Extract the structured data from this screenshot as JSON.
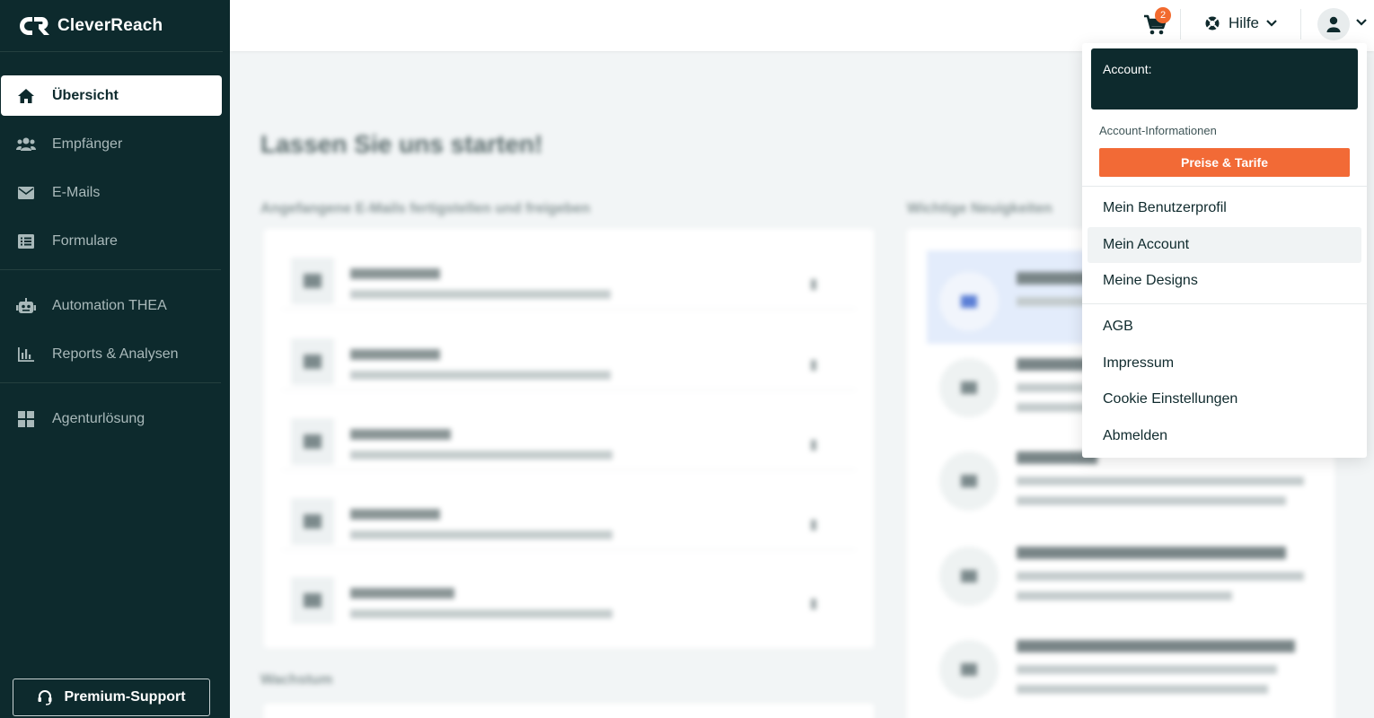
{
  "brand": {
    "name": "CleverReach"
  },
  "sidebar": {
    "items": [
      {
        "label": "Übersicht",
        "icon": "home-icon",
        "active": true
      },
      {
        "label": "Empfänger",
        "icon": "users-icon"
      },
      {
        "label": "E-Mails",
        "icon": "envelope-icon"
      },
      {
        "label": "Formulare",
        "icon": "list-icon"
      },
      {
        "label": "Automation THEA",
        "icon": "robot-icon"
      },
      {
        "label": "Reports & Analysen",
        "icon": "bar-chart-icon"
      },
      {
        "label": "Agenturlösung",
        "icon": "grid-icon"
      }
    ],
    "premium_support": "Premium-Support"
  },
  "topbar": {
    "cart_count": "2",
    "help_label": "Hilfe"
  },
  "content": {
    "heading": "Lassen Sie uns starten!",
    "left_section_title": "Angefangene E-Mails fertigstellen und freigeben",
    "right_section_title": "Wichtige Neuigkeiten",
    "bottom_section_title": "Wachstum"
  },
  "dropdown": {
    "account_label": "Account:",
    "account_info": "Account-Informationen",
    "pricing_button": "Preise & Tarife",
    "items": [
      "Mein Benutzerprofil",
      "Mein Account",
      "Meine Designs",
      "AGB",
      "Impressum",
      "Cookie Einstellungen",
      "Abmelden"
    ]
  },
  "colors": {
    "sidebar_bg": "#0d2a2d",
    "accent_orange": "#f26a36",
    "badge_orange": "#f26a2e"
  }
}
